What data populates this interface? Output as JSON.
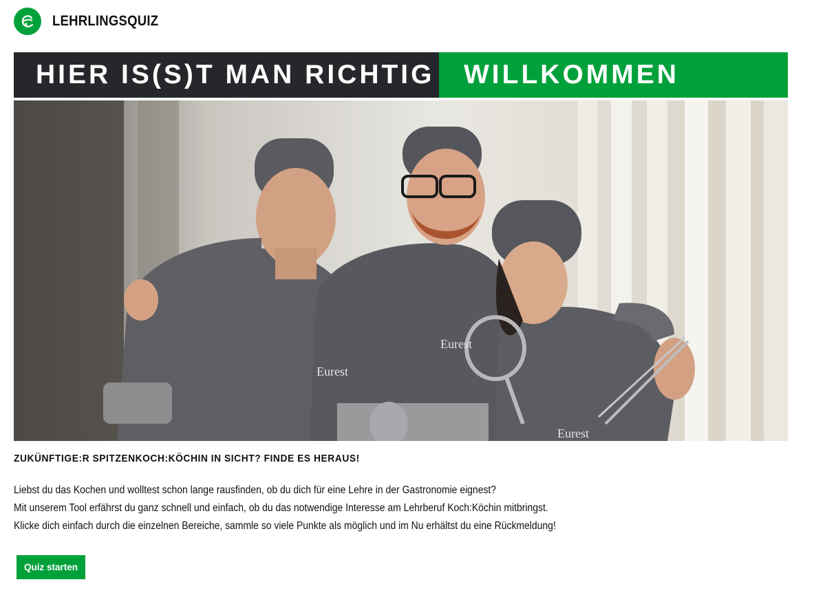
{
  "header": {
    "logo_icon": "eurest-logo-icon",
    "title": "LEHRLINGSQUIZ"
  },
  "banner": {
    "left_text": "HIER IS(S)T MAN RICHTIG",
    "right_text": "WILLKOMMEN"
  },
  "hero": {
    "image_subject": "three chefs in grey uniforms",
    "uniform_brand": "Eurest"
  },
  "content": {
    "headline": "ZUKÜNFTIGE:R SPITZENKOCH:KÖCHIN IN SICHT? FINDE ES HERAUS!",
    "paragraphs": [
      "Liebst du das Kochen und wolltest schon lange rausfinden, ob du dich für eine Lehre in der Gastronomie eignest?",
      "Mit unserem Tool erfährst du ganz schnell und einfach, ob du das notwendige Interesse am Lehrberuf Koch:Köchin mitbringst.",
      "Klicke dich einfach durch die einzelnen Bereiche, sammle so viele Punkte als möglich und im Nu erhältst du eine Rückmeldung!"
    ],
    "start_button": "Quiz starten"
  },
  "colors": {
    "brand_green": "#00a13a",
    "dark": "#26272b"
  }
}
